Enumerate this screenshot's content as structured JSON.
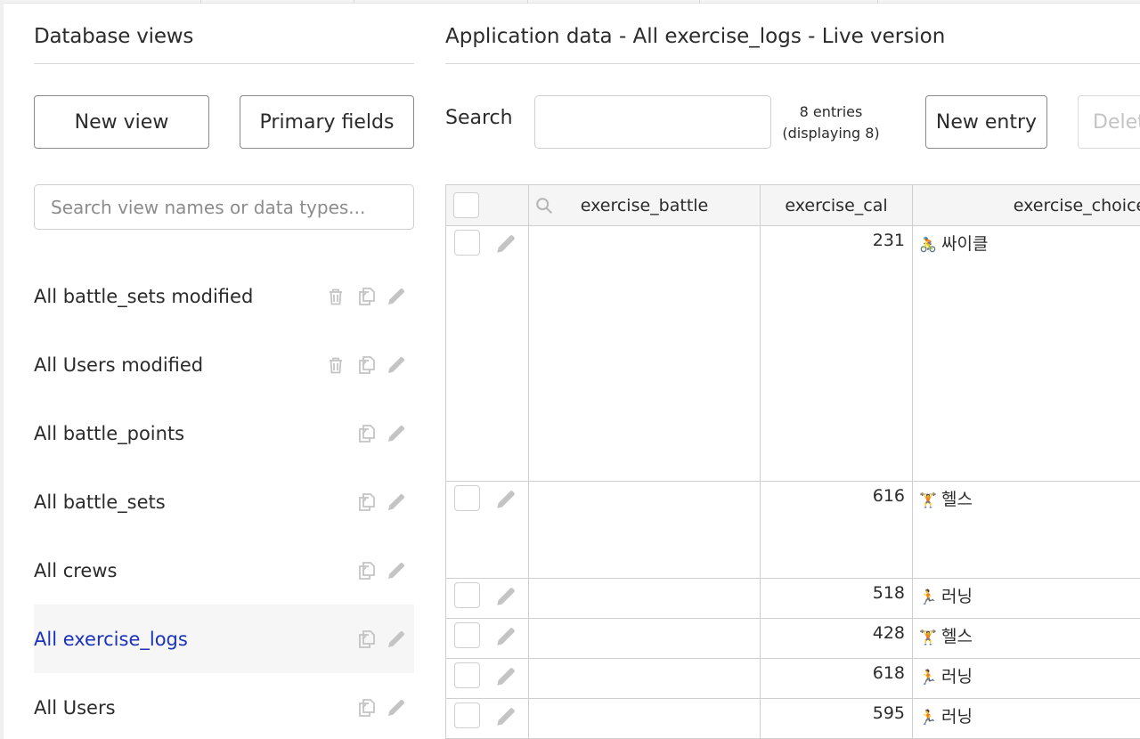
{
  "left_panel": {
    "title": "Database views",
    "new_view_label": "New view",
    "primary_fields_label": "Primary fields",
    "search_placeholder": "Search view names or data types...",
    "views": [
      {
        "name": "All battle_sets modified",
        "deletable": true,
        "selected": false
      },
      {
        "name": "All Users modified",
        "deletable": true,
        "selected": false
      },
      {
        "name": "All battle_points",
        "deletable": false,
        "selected": false
      },
      {
        "name": "All battle_sets",
        "deletable": false,
        "selected": false
      },
      {
        "name": "All crews",
        "deletable": false,
        "selected": false
      },
      {
        "name": "All exercise_logs",
        "deletable": false,
        "selected": true
      },
      {
        "name": "All Users",
        "deletable": false,
        "selected": false
      }
    ]
  },
  "main": {
    "title": "Application data - All exercise_logs - Live version",
    "search_label": "Search",
    "search_value": "",
    "entries_count": "8 entries",
    "entries_displaying": "(displaying 8)",
    "new_entry_label": "New entry",
    "delete_label": "Delete"
  },
  "table": {
    "columns": [
      "exercise_battle",
      "exercise_cal",
      "exercise_choice"
    ],
    "rows": [
      {
        "battle": "",
        "cal": "231",
        "choice_icon": "🚴",
        "choice": "싸이클"
      },
      {
        "battle": "",
        "cal": "616",
        "choice_icon": "🏋",
        "choice": "헬스"
      },
      {
        "battle": "",
        "cal": "518",
        "choice_icon": "🏃",
        "choice": "러닝"
      },
      {
        "battle": "",
        "cal": "428",
        "choice_icon": "🏋",
        "choice": "헬스"
      },
      {
        "battle": "",
        "cal": "618",
        "choice_icon": "🏃",
        "choice": "러닝"
      },
      {
        "battle": "",
        "cal": "595",
        "choice_icon": "🏃",
        "choice": "러닝"
      }
    ]
  },
  "colors": {
    "selected_text": "#1a33b8",
    "icon_gray": "#c4c4c4",
    "border": "#cfcfcf"
  }
}
